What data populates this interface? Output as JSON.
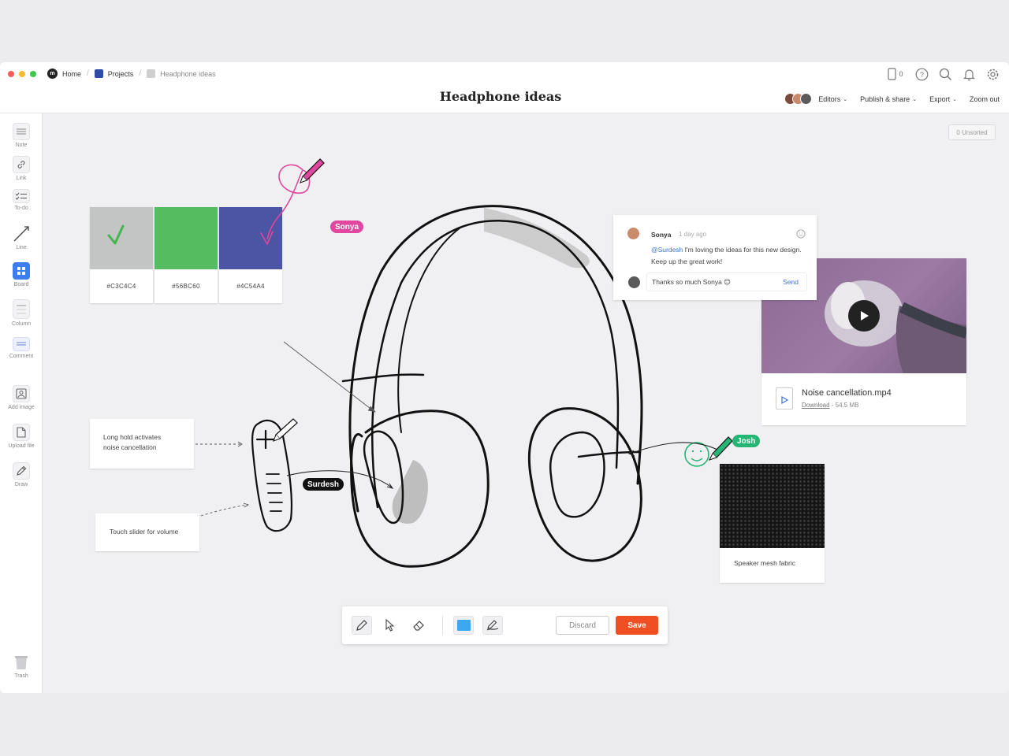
{
  "window": {
    "dot_colors": [
      "#f25f58",
      "#f8bb2d",
      "#3ec84a"
    ]
  },
  "breadcrumb": {
    "home": "Home",
    "projects": "Projects",
    "current": "Headphone ideas",
    "projects_color": "#2f4da8",
    "current_color": "#cfcfd2"
  },
  "header": {
    "title": "Headphone ideas",
    "mobile_count": "0",
    "editors": "Editors",
    "publish": "Publish & share",
    "export": "Export",
    "zoom": "Zoom out"
  },
  "sidebar": {
    "note": "Note",
    "link": "Link",
    "todo": "To-do",
    "line": "Line",
    "board": "Board",
    "column": "Column",
    "comment": "Comment",
    "add_image": "Add image",
    "upload_file": "Upload file",
    "draw": "Draw",
    "trash": "Trash"
  },
  "canvas": {
    "unsorted": "0 Unsorted",
    "swatches": [
      {
        "color": "#C3C4C4",
        "label": "#C3C4C4"
      },
      {
        "color": "#56BC60",
        "label": "#56BC60"
      },
      {
        "color": "#4C54A4",
        "label": "#4C54A4"
      }
    ],
    "cursors": {
      "sonya": {
        "name": "Sonya",
        "color": "#e0479e"
      },
      "surdesh": {
        "name": "Surdesh",
        "color": "#111111"
      },
      "josh": {
        "name": "Josh",
        "color": "#25b575"
      }
    },
    "notes": {
      "long_hold_line1": "Long hold activates",
      "long_hold_line2": "noise cancellation",
      "touch_slider": "Touch slider for volume",
      "mesh_label": "Speaker mesh fabric"
    },
    "comment": {
      "author": "Sonya",
      "time": "1 day ago",
      "mention": "@Surdesh",
      "text": " I'm loving the ideas for this new design. Keep up the great work!",
      "reply": "Thanks so much Sonya 😊",
      "send": "Send"
    },
    "video": {
      "file_name": "Noise cancellation.mp4",
      "download": "Download",
      "size": " - 54.5 MB"
    }
  },
  "draw_toolbar": {
    "fill_color": "#3da7f0",
    "discard": "Discard",
    "save": "Save"
  }
}
